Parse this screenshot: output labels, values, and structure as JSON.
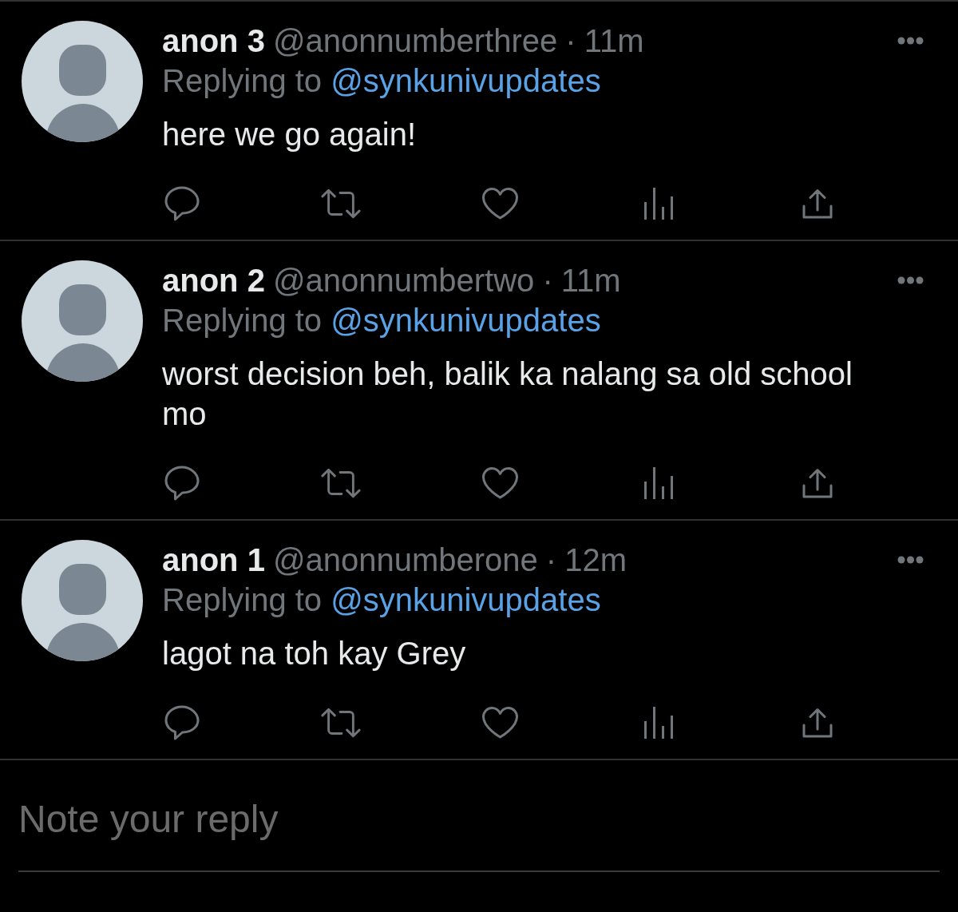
{
  "replies": [
    {
      "name": "anon 3",
      "handle": "@anonnumberthree",
      "separator": "·",
      "time": "11m",
      "reply_context": {
        "label": "Replying to",
        "mention": "@synkunivupdates"
      },
      "text": "here we go again!"
    },
    {
      "name": "anon 2",
      "handle": "@anonnumbertwo",
      "separator": "·",
      "time": "11m",
      "reply_context": {
        "label": "Replying to",
        "mention": "@synkunivupdates"
      },
      "text": "worst decision beh, balik ka nalang sa old school mo"
    },
    {
      "name": "anon 1",
      "handle": "@anonnumberone",
      "separator": "·",
      "time": "12m",
      "reply_context": {
        "label": "Replying to",
        "mention": "@synkunivupdates"
      },
      "text": "lagot na toh kay Grey"
    }
  ],
  "reply_box": {
    "placeholder": "Note your reply"
  }
}
